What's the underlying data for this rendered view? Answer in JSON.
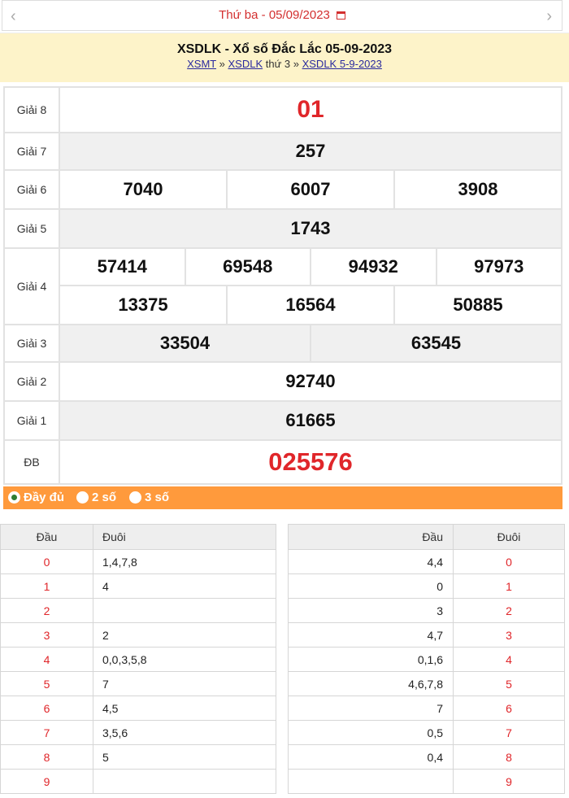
{
  "nav": {
    "date_text": "Thứ ba - 05/09/2023",
    "prev": "‹",
    "next": "›"
  },
  "title": {
    "heading": "XSDLK - Xổ số Đắc Lắc 05-09-2023",
    "crumb1": "XSMT",
    "sep1": " » ",
    "crumb2": "XSDLK",
    "mid": " thứ 3 ",
    "sep2": "» ",
    "crumb3": "XSDLK 5-9-2023"
  },
  "prizes": {
    "g8": {
      "label": "Giải 8",
      "values": [
        "01"
      ]
    },
    "g7": {
      "label": "Giải 7",
      "values": [
        "257"
      ]
    },
    "g6": {
      "label": "Giải 6",
      "values": [
        "7040",
        "6007",
        "3908"
      ]
    },
    "g5": {
      "label": "Giải 5",
      "values": [
        "1743"
      ]
    },
    "g4": {
      "label": "Giải 4",
      "values": [
        "57414",
        "69548",
        "94932",
        "97973",
        "13375",
        "16564",
        "50885"
      ]
    },
    "g3": {
      "label": "Giải 3",
      "values": [
        "33504",
        "63545"
      ]
    },
    "g2": {
      "label": "Giải 2",
      "values": [
        "92740"
      ]
    },
    "g1": {
      "label": "Giải 1",
      "values": [
        "61665"
      ]
    },
    "db": {
      "label": "ĐB",
      "values": [
        "025576"
      ]
    }
  },
  "options": [
    {
      "label": "Đầy đủ",
      "selected": true
    },
    {
      "label": "2 số",
      "selected": false
    },
    {
      "label": "3 số",
      "selected": false
    }
  ],
  "dau_table": {
    "headers": [
      "Đầu",
      "Đuôi"
    ],
    "rows": [
      [
        "0",
        "1,4,7,8"
      ],
      [
        "1",
        "4"
      ],
      [
        "2",
        ""
      ],
      [
        "3",
        "2"
      ],
      [
        "4",
        "0,0,3,5,8"
      ],
      [
        "5",
        "7"
      ],
      [
        "6",
        "4,5"
      ],
      [
        "7",
        "3,5,6"
      ],
      [
        "8",
        "5"
      ],
      [
        "9",
        ""
      ]
    ]
  },
  "duoi_table": {
    "headers": [
      "Đầu",
      "Đuôi"
    ],
    "rows": [
      [
        "4,4",
        "0"
      ],
      [
        "0",
        "1"
      ],
      [
        "3",
        "2"
      ],
      [
        "4,7",
        "3"
      ],
      [
        "0,1,6",
        "4"
      ],
      [
        "4,6,7,8",
        "5"
      ],
      [
        "7",
        "6"
      ],
      [
        "0,5",
        "7"
      ],
      [
        "0,4",
        "8"
      ],
      [
        "",
        "9"
      ]
    ]
  },
  "colors": {
    "accent_red": "#e0262a",
    "orange_bar": "#ff9a3c",
    "title_bg": "#fdf3c9"
  }
}
